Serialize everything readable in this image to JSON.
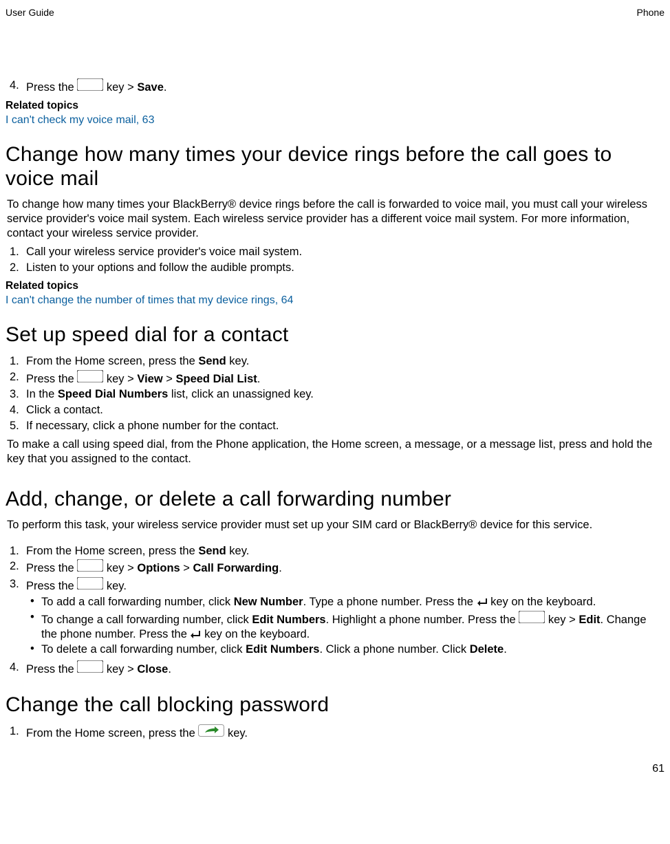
{
  "header": {
    "left": "User Guide",
    "right": "Phone"
  },
  "footer": {
    "page_number": "61"
  },
  "step4": {
    "marker": "4.",
    "pre": "Press the ",
    "post": " key > ",
    "save": "Save",
    "end": "."
  },
  "rel1": {
    "heading": "Related topics",
    "link": "I can't check my voice mail, 63"
  },
  "sec1": {
    "title": "Change how many times your device rings before the call goes to voice mail",
    "intro": "To change how many times your BlackBerry® device rings before the call is forwarded to voice mail, you must call your wireless service provider's voice mail system. Each wireless service provider has a different voice mail system. For more information, contact your wireless service provider.",
    "step1": {
      "marker": "1.",
      "text": "Call your wireless service provider's voice mail system."
    },
    "step2": {
      "marker": "2.",
      "text": "Listen to your options and follow the audible prompts."
    }
  },
  "rel2": {
    "heading": "Related topics",
    "link": "I can't change the number of times that my device rings, 64"
  },
  "sec2": {
    "title": "Set up speed dial for a contact",
    "step1": {
      "marker": "1.",
      "pre": "From the Home screen, press the ",
      "send": "Send",
      "post": " key."
    },
    "step2": {
      "marker": "2.",
      "pre": "Press the ",
      "mid": " key > ",
      "view": "View",
      "gt": " > ",
      "sdl": "Speed Dial List",
      "end": "."
    },
    "step3": {
      "marker": "3.",
      "pre": "In the ",
      "sdn": "Speed Dial Numbers",
      "post": " list, click an unassigned key."
    },
    "step4": {
      "marker": "4.",
      "text": "Click a contact."
    },
    "step5": {
      "marker": "5.",
      "text": "If necessary, click a phone number for the contact."
    },
    "outro": "To make a call using speed dial, from the Phone application, the Home screen, a message, or a message list, press and hold the key that you assigned to the contact."
  },
  "sec3": {
    "title": "Add, change, or delete a call forwarding number",
    "intro": "To perform this task, your wireless service provider must set up your SIM card or BlackBerry® device for this service.",
    "step1": {
      "marker": "1.",
      "pre": "From the Home screen, press the ",
      "send": "Send",
      "post": " key."
    },
    "step2": {
      "marker": "2.",
      "pre": "Press the ",
      "mid": " key > ",
      "options": "Options",
      "gt": " > ",
      "cf": "Call Forwarding",
      "end": "."
    },
    "step3": {
      "marker": "3.",
      "pre": "Press the ",
      "post": " key."
    },
    "bullet1": {
      "pre": "To add a call forwarding number, click ",
      "nn": "New Number",
      "mid": ". Type a phone number. Press the ",
      "post": " key on the keyboard."
    },
    "bullet2": {
      "pre": "To change a call forwarding number, click ",
      "en": "Edit Numbers",
      "mid1": ". Highlight a phone number. Press the ",
      "mid2": " key > ",
      "edit": "Edit",
      "mid3": ". Change the phone number. Press the ",
      "post": " key on the keyboard."
    },
    "bullet3": {
      "pre": "To delete a call forwarding number, click ",
      "en": "Edit Numbers",
      "mid": ". Click a phone number. Click ",
      "delete": "Delete",
      "end": "."
    },
    "step4": {
      "marker": "4.",
      "pre": "Press the ",
      "mid": " key > ",
      "close": "Close",
      "end": "."
    }
  },
  "sec4": {
    "title": "Change the call blocking password",
    "step1": {
      "marker": "1.",
      "pre": "From the Home screen, press the ",
      "post": " key."
    }
  }
}
